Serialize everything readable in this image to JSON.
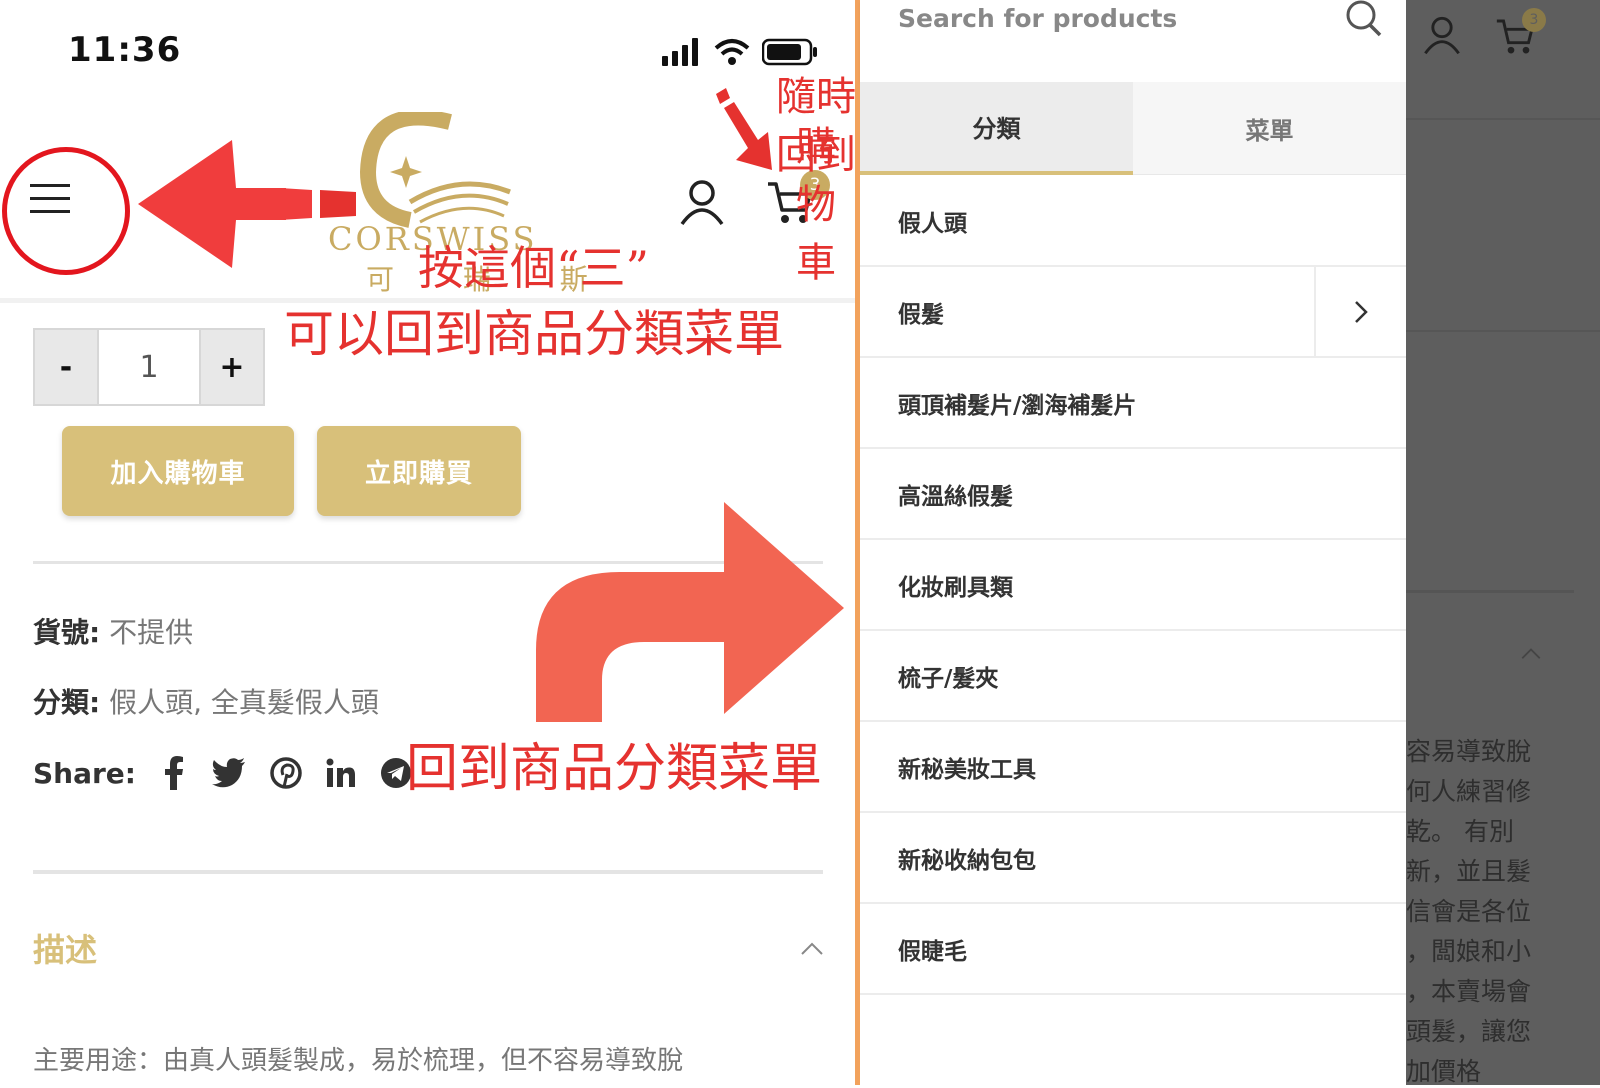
{
  "status_bar": {
    "time": "11:36"
  },
  "header": {
    "logo_text": "CORSWISS",
    "logo_subtext": "可 瑞 斯",
    "cart_count": "3"
  },
  "annotations": {
    "hamburger_hint_line1": "按這個“三”",
    "hamburger_hint_line2": "可以回到商品分類菜單",
    "cart_hint_line1": "隨時回到",
    "cart_hint_line2": "購物車",
    "menu_hint": "回到商品分類菜單"
  },
  "product": {
    "qty_minus": "-",
    "qty_value": "1",
    "qty_plus": "+",
    "add_to_cart": "加入購物車",
    "buy_now": "立即購買",
    "sku_label": "貨號:",
    "sku_value": "不提供",
    "category_label": "分類:",
    "category_value": "假人頭, 全真髮假人頭",
    "share_label": "Share:",
    "share_icons": [
      "facebook-icon",
      "twitter-icon",
      "pinterest-icon",
      "linkedin-icon",
      "telegram-icon"
    ],
    "description_title": "描述",
    "description_text": "主要用途：由真人頭髮製成，易於梳理，但不容易導致脫"
  },
  "menu": {
    "search_placeholder": "Search for products",
    "tabs": [
      {
        "label": "分類",
        "active": true
      },
      {
        "label": "菜單",
        "active": false
      }
    ],
    "items": [
      {
        "label": "假人頭"
      },
      {
        "label": "假髮",
        "has_submenu": true
      },
      {
        "label": "頭頂補髮片/瀏海補髮片"
      },
      {
        "label": "高溫絲假髮"
      },
      {
        "label": "化妝刷具類"
      },
      {
        "label": "梳子/髮夾"
      },
      {
        "label": "新秘美妝工具"
      },
      {
        "label": "新秘收納包包"
      },
      {
        "label": "假睫毛"
      }
    ]
  },
  "overlay": {
    "cart_count": "3",
    "text_lines": [
      "容易導致脫",
      "何人練習修",
      "乾。 有別",
      "新，並且髮",
      "信會是各位",
      "，闆娘和小",
      "，本賣場會",
      "頭髮，讓您",
      "加價格"
    ]
  },
  "colors": {
    "gold": "#d8c07a",
    "annotation_red": "#e5322f",
    "orange_divider": "#f2a25c",
    "overlay": "#5e5e5e"
  }
}
